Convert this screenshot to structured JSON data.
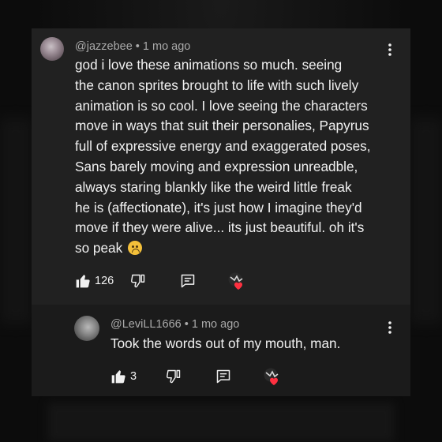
{
  "comment": {
    "author": "@jazzebee",
    "time": "1 mo ago",
    "text": "god i love these animations so much. seeing\nthe canon sprites brought to life with such lively\nanimation is so cool. I love seeing the characters\nmove in ways that suit their personalies,  Papyrus\nfull of expressive energy and exaggerated poses,\nSans barely moving and expression unreadble,\nalways staring blankly like the weird little freak\nhe is (affectionate), it's just how I imagine they'd\nmove if they were alive... its just beautiful. oh it's\nso peak",
    "like_count": "126"
  },
  "reply": {
    "author": "@LeviLL1666",
    "time": "1 mo ago",
    "text": "Took the words out of my mouth, man.",
    "like_count": "3"
  },
  "separator": " • ",
  "colors": {
    "card": "#212121",
    "reply_card": "#1b1b1b",
    "meta": "#aaaaaa",
    "heart": "#ff3040"
  },
  "icons": [
    "more-vert-icon",
    "thumb-up-icon",
    "thumb-down-icon",
    "reply-icon",
    "creator-heart-icon",
    "crying-face-emoji"
  ]
}
